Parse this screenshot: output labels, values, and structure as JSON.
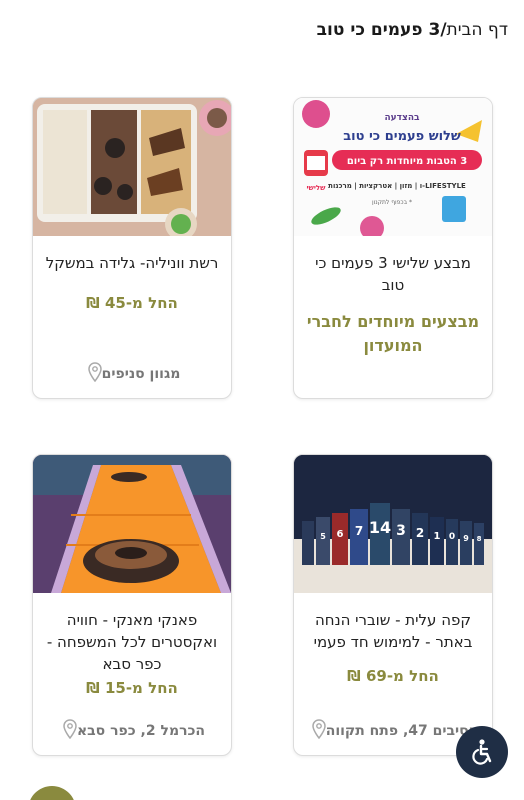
{
  "breadcrumb": {
    "home": "דף הבית",
    "separator": "/",
    "current": "3 פעמים כי טוב"
  },
  "cards": [
    {
      "title": "מבצע שלישי 3 פעמים כי טוב",
      "subtitle": "מבצעים מיוחדים לחברי המועדון",
      "banner": {
        "brand": "בהצדעה",
        "headline": "שלוש פעמים כי טוב",
        "ribbon": "3 הטבות מיוחדות רק ביום",
        "day_badge": "שלישי",
        "tags": "LIFESTYLE-ו | מזון | אטרקציות | מרכנות",
        "footnote": "* בכפוף לתקנון"
      }
    },
    {
      "title": "רשת ווניליה- גלידה במשקל",
      "price": "החל מ-45 ₪",
      "location": "מגוון סניפים"
    },
    {
      "title": "קפה עלית - שוברי הנחה באתר - למימוש חד פעמי",
      "price": "החל מ-69 ₪",
      "location": "הסיבים 47, פתח תקווה",
      "pack_numbers": [
        "14",
        "3",
        "2",
        "1",
        "0",
        "9",
        "8",
        "7",
        "6",
        "5"
      ]
    },
    {
      "title": "פאנקי מאנקי - חוויה ואקסטרים לכל המשפחה - כפר סבא",
      "price": "החל מ-15 ₪",
      "location": "הכרמל 2, כפר סבא"
    }
  ],
  "colors": {
    "accent_olive": "#8a8a3e",
    "accessibility_bg": "#1f2e45"
  }
}
